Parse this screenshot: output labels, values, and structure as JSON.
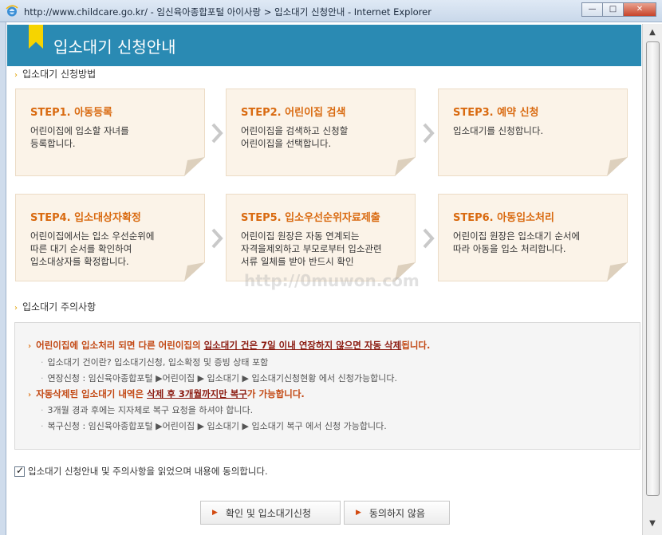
{
  "window": {
    "title": "http://www.childcare.go.kr/ - 임신육아종합포털 아이사랑 > 입소대기 신청안내 - Internet Explorer",
    "minimize": "—",
    "maximize": "□",
    "close": "✕"
  },
  "header": {
    "title": "입소대기 신청안내"
  },
  "sections": {
    "method": "입소대기 신청방법",
    "caution": "입소대기 주의사항"
  },
  "steps": [
    {
      "title": "STEP1. 아동등록",
      "desc": "어린이집에 입소할 자녀를\n등록합니다."
    },
    {
      "title": "STEP2. 어린이집 검색",
      "desc": "어린이집을 검색하고 신청할\n어린이집을 선택합니다."
    },
    {
      "title": "STEP3. 예약 신청",
      "desc": "입소대기를 신청합니다."
    },
    {
      "title": "STEP4. 입소대상자확정",
      "desc": "어린이집에서는 입소 우선순위에\n따른 대기 순서를 확인하여\n입소대상자를 확정합니다."
    },
    {
      "title": "STEP5. 입소우선순위자료제출",
      "desc": "어린이집 원장은 자동 연계되는\n자격을제외하고 부모로부터 입소관련\n서류 일체를 받아 반드시 확인"
    },
    {
      "title": "STEP6. 아동입소처리",
      "desc": "어린이집 원장은 입소대기 순서에\n따라 아동을 입소 처리합니다."
    }
  ],
  "notice": {
    "main1": {
      "a": "어린이집에 입소처리 되면 다른 어린이집의 ",
      "b": "입소대기 건은 7일 이내 연장하지 않으면 자동 삭제",
      "c": "됩니다."
    },
    "sub1": "입소대기 건이란? 입소대기신청, 입소확정 및 증빙 상태 포함",
    "sub2": "연장신청 : 임신육아종합포털 ▶어린이집 ▶ 입소대기 ▶ 입소대기신청현황 에서 신청가능합니다.",
    "main2": {
      "a": "자동삭제된 입소대기 내역은 ",
      "b": "삭제 후 3개월까지만 복구",
      "c": "가 가능합니다."
    },
    "sub3": "3개월 경과 후에는 지자체로 복구 요청을 하셔야 합니다.",
    "sub4": "복구신청 : 임신육아종합포털 ▶어린이집 ▶ 입소대기 ▶ 입소대기 복구 에서 신청 가능합니다."
  },
  "agree": {
    "checked": true,
    "label": "입소대기 신청안내 및 주의사항을 읽었으며 내용에 동의합니다."
  },
  "buttons": {
    "confirm": "확인 및 입소대기신청",
    "disagree": "동의하지 않음"
  },
  "watermark": "http://0muwon.com",
  "colors": {
    "header": "#2a8ab3",
    "step_title": "#d96a10",
    "notice_red": "#c24712",
    "card_bg": "#fbf3e8"
  }
}
